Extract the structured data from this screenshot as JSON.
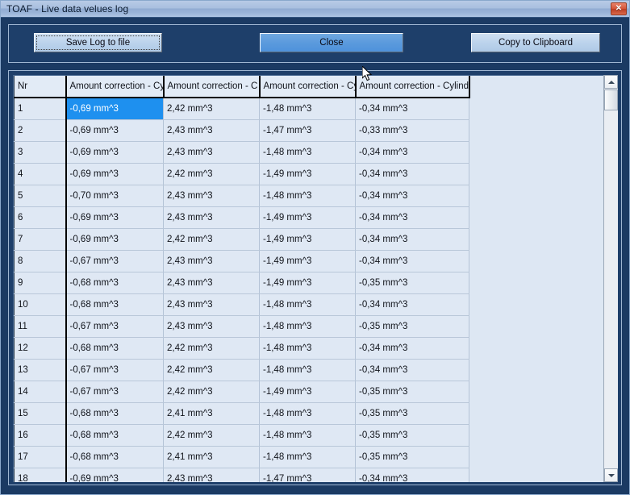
{
  "window": {
    "title": "TOAF - Live data velues log",
    "close_label": "✕"
  },
  "toolbar": {
    "save_label": "Save Log to file",
    "close_label": "Close",
    "copy_label": "Copy to Clipboard"
  },
  "scrollbar": {
    "up_label": "",
    "down_label": ""
  },
  "table": {
    "headers": [
      "Nr",
      "Amount correction - Cyli",
      "Amount correction - C",
      "Amount correction - Cy",
      "Amount correction - Cylinder"
    ],
    "selected_cell": {
      "row": 0,
      "col": 1
    },
    "rows": [
      [
        "1",
        "-0,69 mm^3",
        "2,42 mm^3",
        "-1,48 mm^3",
        "-0,34 mm^3"
      ],
      [
        "2",
        "-0,69 mm^3",
        "2,43 mm^3",
        "-1,47 mm^3",
        "-0,33 mm^3"
      ],
      [
        "3",
        "-0,69 mm^3",
        "2,43 mm^3",
        "-1,48 mm^3",
        "-0,34 mm^3"
      ],
      [
        "4",
        "-0,69 mm^3",
        "2,42 mm^3",
        "-1,49 mm^3",
        "-0,34 mm^3"
      ],
      [
        "5",
        "-0,70 mm^3",
        "2,43 mm^3",
        "-1,48 mm^3",
        "-0,34 mm^3"
      ],
      [
        "6",
        "-0,69 mm^3",
        "2,43 mm^3",
        "-1,49 mm^3",
        "-0,34 mm^3"
      ],
      [
        "7",
        "-0,69 mm^3",
        "2,42 mm^3",
        "-1,49 mm^3",
        "-0,34 mm^3"
      ],
      [
        "8",
        "-0,67 mm^3",
        "2,43 mm^3",
        "-1,49 mm^3",
        "-0,34 mm^3"
      ],
      [
        "9",
        "-0,68 mm^3",
        "2,43 mm^3",
        "-1,49 mm^3",
        "-0,35 mm^3"
      ],
      [
        "10",
        "-0,68 mm^3",
        "2,43 mm^3",
        "-1,48 mm^3",
        "-0,34 mm^3"
      ],
      [
        "11",
        "-0,67 mm^3",
        "2,43 mm^3",
        "-1,48 mm^3",
        "-0,35 mm^3"
      ],
      [
        "12",
        "-0,68 mm^3",
        "2,42 mm^3",
        "-1,48 mm^3",
        "-0,34 mm^3"
      ],
      [
        "13",
        "-0,67 mm^3",
        "2,42 mm^3",
        "-1,48 mm^3",
        "-0,34 mm^3"
      ],
      [
        "14",
        "-0,67 mm^3",
        "2,42 mm^3",
        "-1,49 mm^3",
        "-0,35 mm^3"
      ],
      [
        "15",
        "-0,68 mm^3",
        "2,41 mm^3",
        "-1,48 mm^3",
        "-0,35 mm^3"
      ],
      [
        "16",
        "-0,68 mm^3",
        "2,42 mm^3",
        "-1,48 mm^3",
        "-0,35 mm^3"
      ],
      [
        "17",
        "-0,68 mm^3",
        "2,41 mm^3",
        "-1,48 mm^3",
        "-0,35 mm^3"
      ],
      [
        "18",
        "-0,69 mm^3",
        "2,43 mm^3",
        "-1,47 mm^3",
        "-0,34 mm^3"
      ]
    ]
  },
  "colors": {
    "window_background": "#1b3a63",
    "selection": "#1e90ef",
    "grid_background": "#dde7f3",
    "close_button": "#d4563a",
    "hover_button": "#5b9add"
  }
}
